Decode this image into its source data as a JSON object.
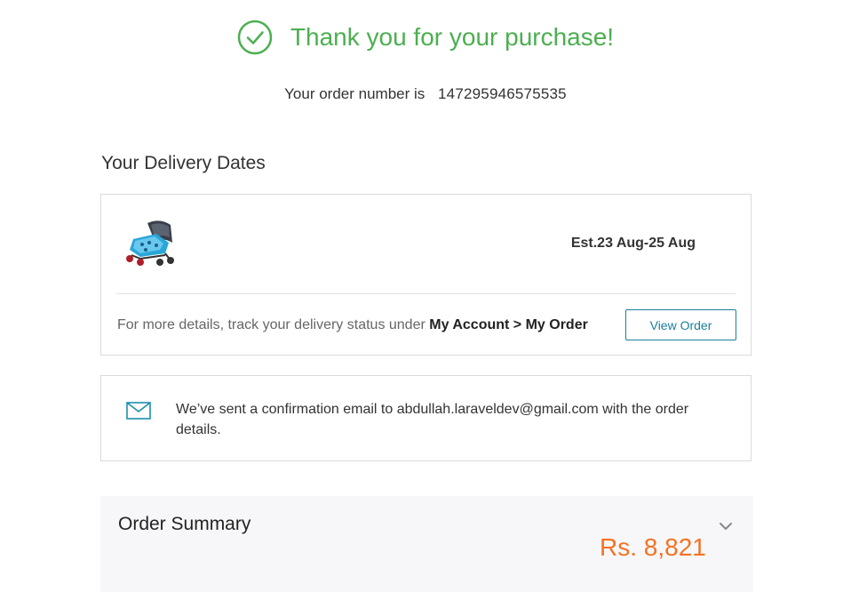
{
  "header": {
    "thank_you": "Thank you for your purchase!",
    "order_number_label": "Your order number is",
    "order_number": "147295946575535",
    "success_color": "#4caf50"
  },
  "delivery": {
    "section_title": "Your Delivery Dates",
    "product_image_icon": "stroller-product-image",
    "estimated_date": "Est.23 Aug-25 Aug",
    "track_prefix": "For more details, track your delivery status under",
    "track_path": "My Account > My Order",
    "view_order_label": "View Order"
  },
  "confirmation": {
    "icon": "mail-icon",
    "message": "We’ve sent a confirmation email to abdullah.laraveldev@gmail.com with the order details."
  },
  "summary": {
    "title": "Order Summary",
    "total": "Rs. 8,821",
    "total_color": "#f57224",
    "expand_icon": "chevron-down-icon"
  }
}
